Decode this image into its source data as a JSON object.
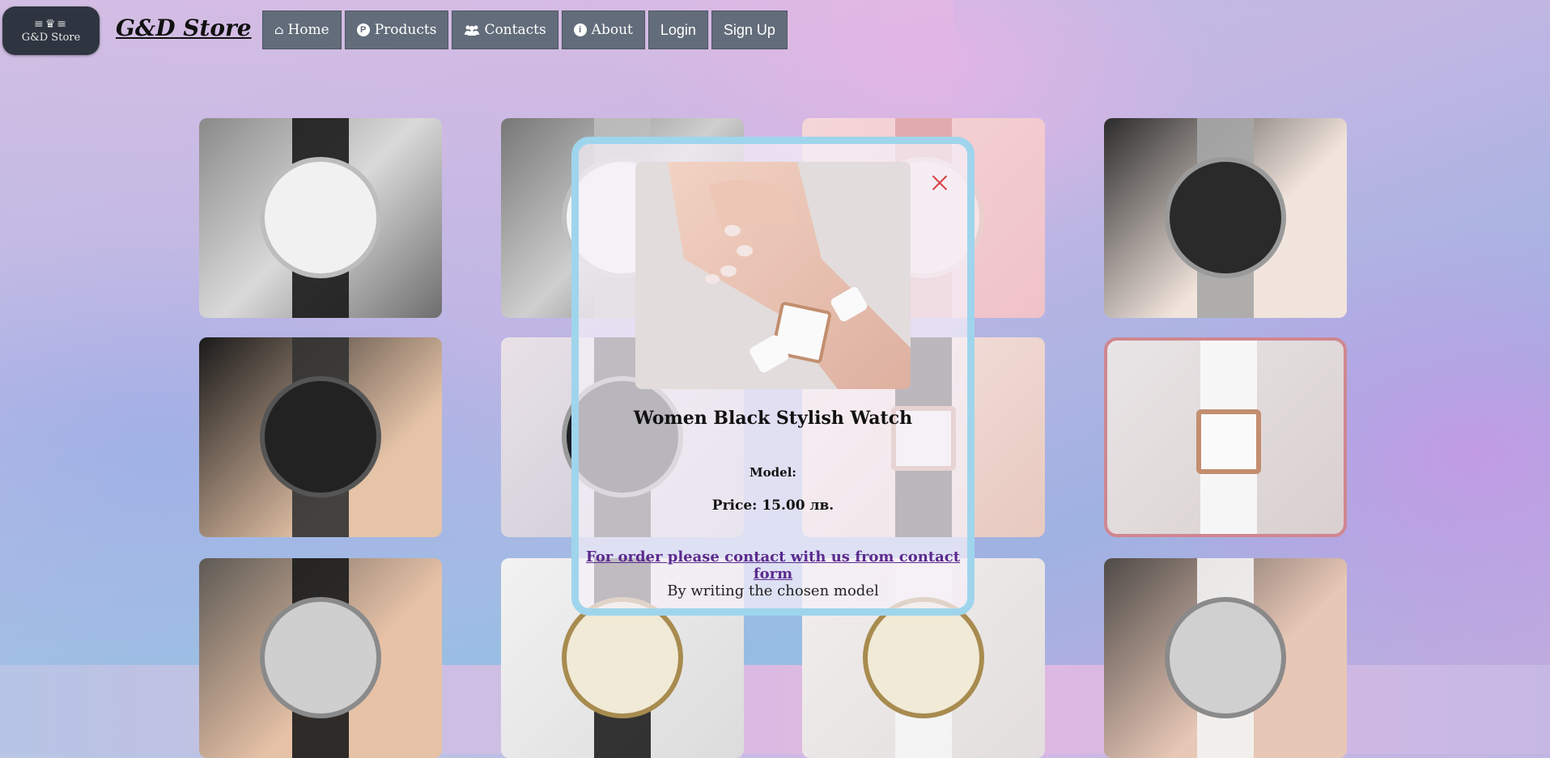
{
  "brand": {
    "logo_text": "G&D Store",
    "logo_crown": "≡♛≡",
    "title": "G&D Store"
  },
  "nav": {
    "items": [
      {
        "label": "Home",
        "icon": "home-icon",
        "glyph": "⌂"
      },
      {
        "label": "Products",
        "icon": "products-icon",
        "glyph": "P"
      },
      {
        "label": "Contacts",
        "icon": "contacts-icon",
        "glyph": "👥"
      },
      {
        "label": "About",
        "icon": "info-icon",
        "glyph": "ℹ"
      },
      {
        "label": "Login"
      },
      {
        "label": "Sign Up"
      }
    ]
  },
  "products": [
    {
      "name": "silver-leather-watch",
      "style": "silver"
    },
    {
      "name": "silver-steel-watch",
      "style": "silver-steel"
    },
    {
      "name": "pink-strap-watch",
      "style": "pink"
    },
    {
      "name": "black-chrono-watch",
      "style": "chrono"
    },
    {
      "name": "black-chrono-wrist",
      "style": "chrono-dark"
    },
    {
      "name": "black-leather-wrist",
      "style": "black-leather"
    },
    {
      "name": "square-black-watch",
      "style": "square-black"
    },
    {
      "name": "women-square-white-watch",
      "style": "square-white",
      "selected": true
    },
    {
      "name": "music-note-black-watch",
      "style": "music-black"
    },
    {
      "name": "vintage-bracelet-black",
      "style": "vintage-black"
    },
    {
      "name": "vintage-bracelet-white",
      "style": "vintage-white"
    },
    {
      "name": "music-note-white-watch",
      "style": "music-white"
    }
  ],
  "modal": {
    "title": "Women Black Stylish Watch",
    "model_label": "Model:",
    "price": "Price: 15.00 лв.",
    "order_link": "For order please contact with us from contact form",
    "note": "By writing the chosen model"
  },
  "colors": {
    "nav_bg": "#626c7a",
    "modal_border": "#9fd5ec",
    "selected_border": "#cf8790",
    "close": "#d94141",
    "link": "#5b2a8e"
  }
}
